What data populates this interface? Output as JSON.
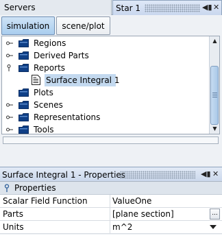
{
  "dock": {
    "servers_tab": "Servers",
    "star_tab": "Star 1",
    "ctl_pin": "◀▮",
    "ctl_close": "✕"
  },
  "subtabs": {
    "simulation": "simulation",
    "scene_plot": "scene/plot",
    "active": "simulation"
  },
  "tree": {
    "items": [
      {
        "label": "Regions"
      },
      {
        "label": "Derived Parts"
      },
      {
        "label": "Reports",
        "expanded": true
      },
      {
        "label": "Surface Integral 1",
        "selected": true
      },
      {
        "label": "Plots"
      },
      {
        "label": "Scenes"
      },
      {
        "label": "Representations"
      },
      {
        "label": "Tools"
      }
    ]
  },
  "properties": {
    "title": "Surface Integral 1 - Properties",
    "section": "Properties",
    "rows": [
      {
        "key": "Scalar Field Function",
        "value": "ValueOne"
      },
      {
        "key": "Parts",
        "value": "[plane section]",
        "button": "..."
      },
      {
        "key": "Units",
        "value": "m^2"
      }
    ]
  },
  "colors": {
    "selection": "#c3d9ef",
    "folder": "#0f3f86",
    "active_tab": "#a9cdee"
  }
}
